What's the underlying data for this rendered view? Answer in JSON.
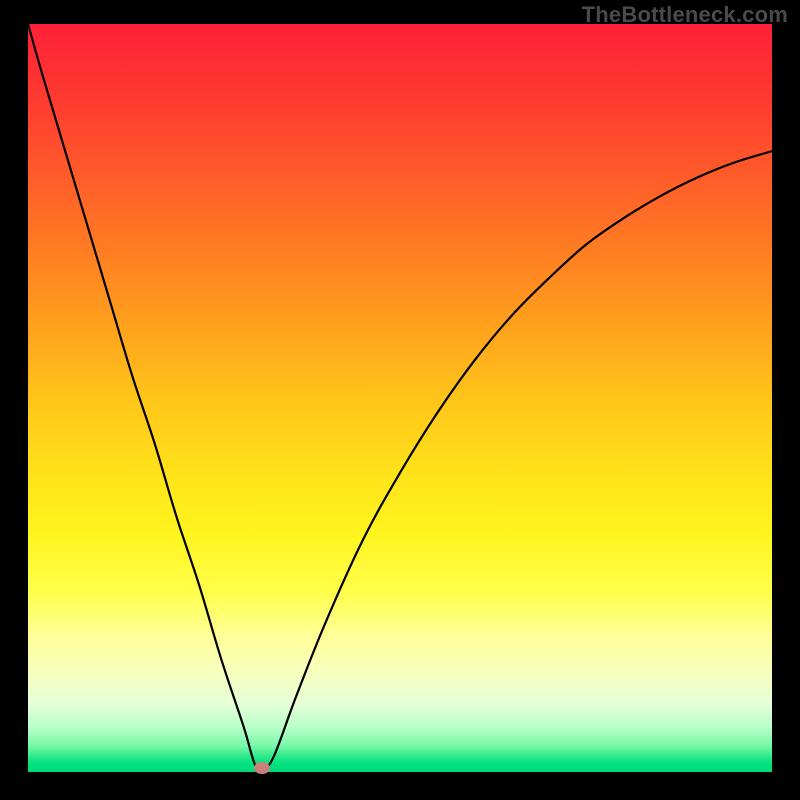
{
  "watermark": "TheBottleneck.com",
  "colors": {
    "frame": "#000000",
    "curve_stroke": "#000000",
    "marker_fill": "#c98079"
  },
  "chart_data": {
    "type": "line",
    "title": "",
    "xlabel": "",
    "ylabel": "",
    "xlim": [
      0,
      100
    ],
    "ylim": [
      0,
      100
    ],
    "grid": false,
    "series": [
      {
        "name": "bottleneck-curve",
        "x": [
          0,
          2,
          5,
          8,
          11,
          14,
          17,
          20,
          23,
          26,
          29,
          30.5,
          31.5,
          33,
          36,
          40,
          45,
          50,
          55,
          60,
          65,
          70,
          75,
          80,
          85,
          90,
          95,
          100
        ],
        "values": [
          100,
          93,
          83,
          73,
          63,
          53,
          44,
          34,
          25,
          15,
          6,
          1,
          0.5,
          2,
          10,
          20,
          31,
          40,
          48,
          55,
          61,
          66,
          70.5,
          74,
          77,
          79.5,
          81.5,
          83
        ]
      }
    ],
    "marker": {
      "x": 31.5,
      "y": 0.5,
      "shape": "ellipse",
      "color": "#c98079"
    },
    "background_gradient_meaning": "higher percentage = warmer color"
  }
}
